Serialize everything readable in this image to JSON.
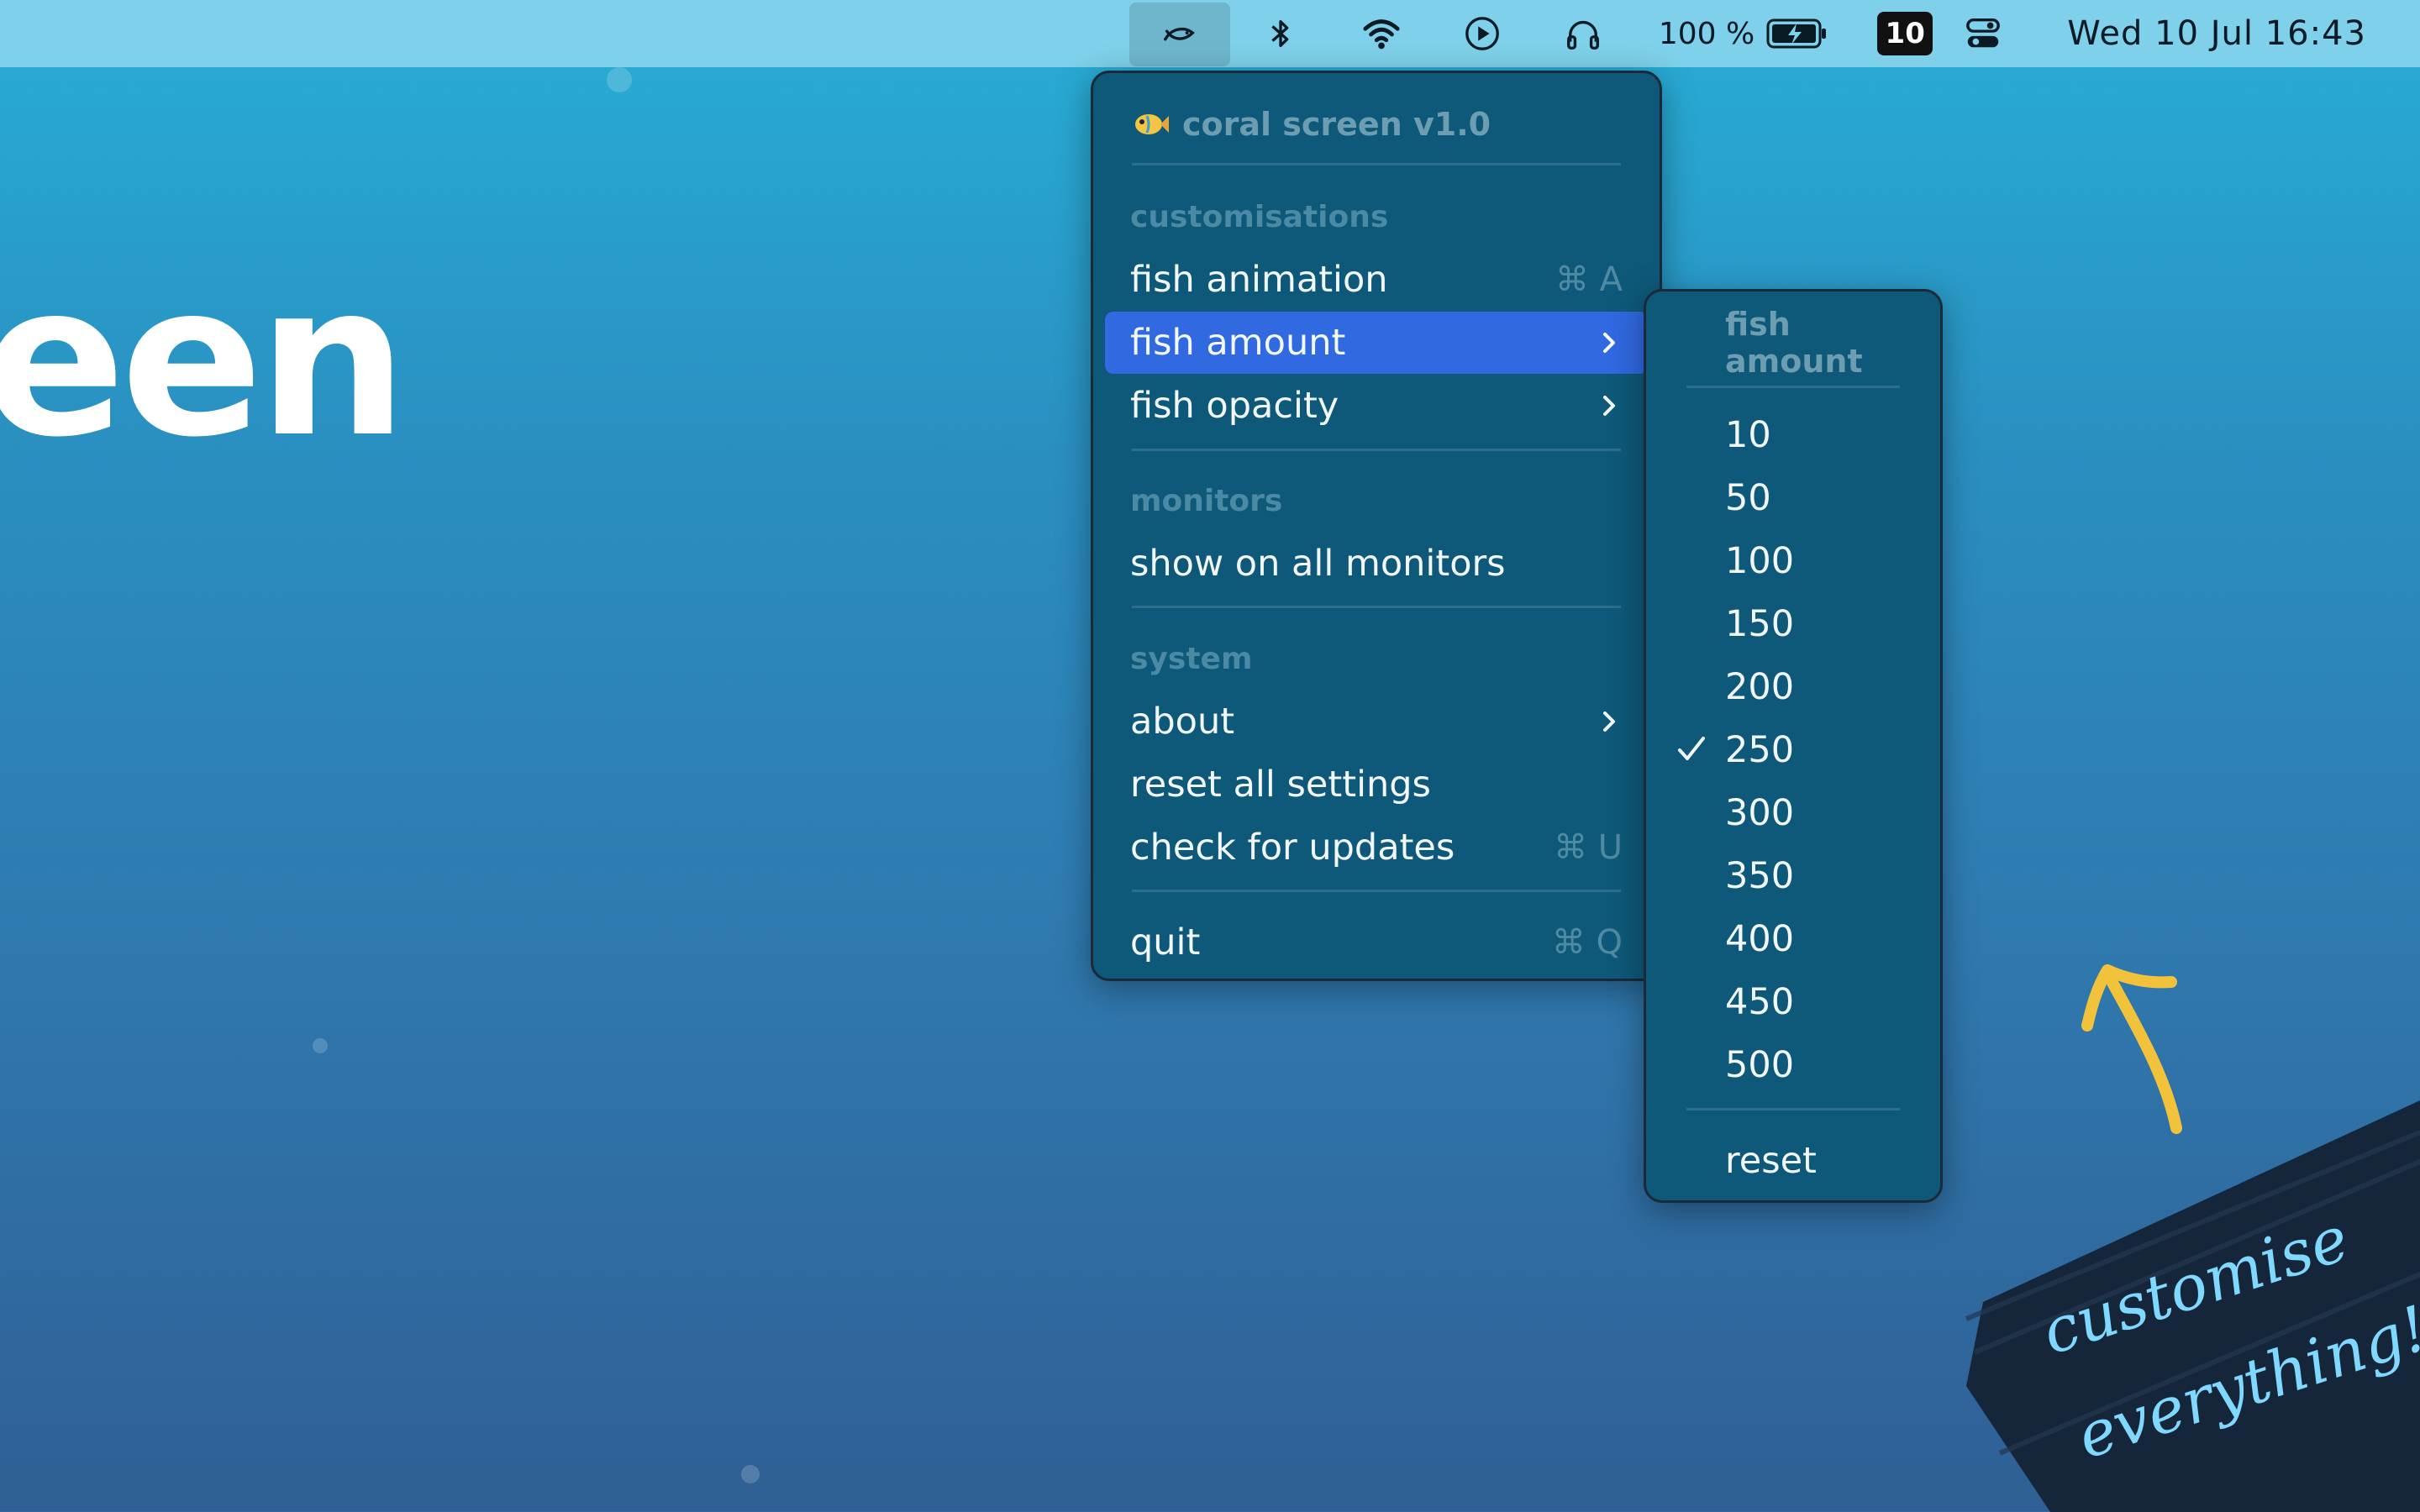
{
  "menubar": {
    "battery_percent": "100 %",
    "badge": "10",
    "clock": "Wed 10 Jul  16:43",
    "icons": [
      "fish-icon",
      "bluetooth-icon",
      "wifi-icon",
      "play-icon",
      "headphones-icon",
      "battery-icon",
      "control-center-icon"
    ]
  },
  "background": {
    "title_fragment": "een",
    "annotation_line1": "customise",
    "annotation_line2": "everything!",
    "annotation_text_color": "#7fd8ff",
    "arrow_color": "#f2c23a"
  },
  "menu": {
    "header": "coral screen v1.0",
    "sections": {
      "customisations": "customisations",
      "monitors": "monitors",
      "system": "system"
    },
    "items": {
      "fish_animation": {
        "label": "fish animation",
        "shortcut": "⌘ A"
      },
      "fish_amount": {
        "label": "fish amount"
      },
      "fish_opacity": {
        "label": "fish opacity"
      },
      "show_on_all_monitors": {
        "label": "show on all monitors"
      },
      "about": {
        "label": "about"
      },
      "reset_all_settings": {
        "label": "reset all settings"
      },
      "check_for_updates": {
        "label": "check for updates",
        "shortcut": "⌘ U"
      },
      "quit": {
        "label": "quit",
        "shortcut": "⌘ Q"
      }
    },
    "highlight_color": "#3069e0"
  },
  "submenu": {
    "header": "fish amount",
    "options": [
      "10",
      "50",
      "100",
      "150",
      "200",
      "250",
      "300",
      "350",
      "400",
      "450",
      "500"
    ],
    "selected": "250",
    "reset": "reset"
  }
}
